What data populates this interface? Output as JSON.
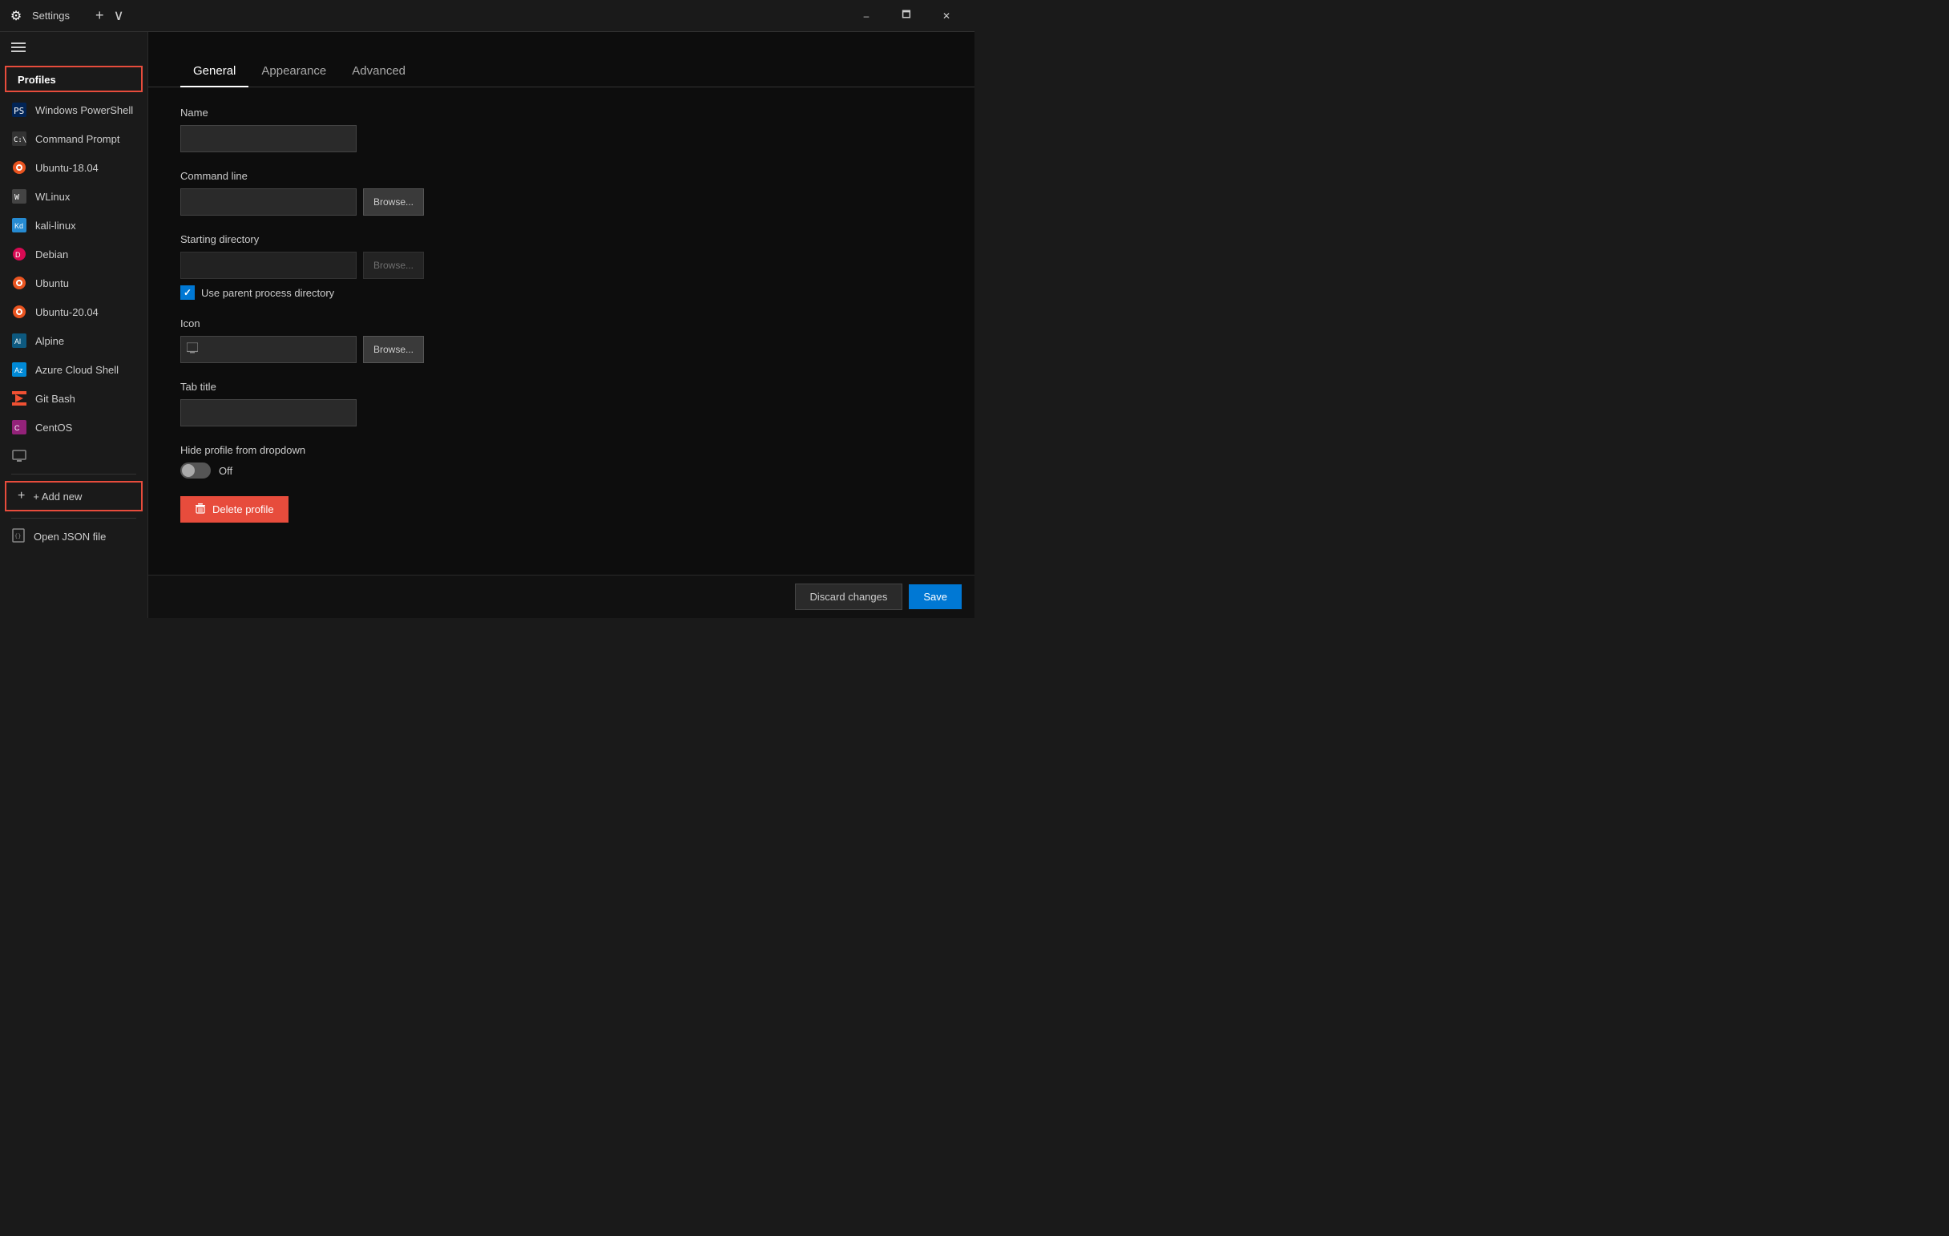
{
  "titleBar": {
    "icon": "⚙",
    "title": "Settings",
    "newTabIcon": "+",
    "dropdownIcon": "∨",
    "minimizeLabel": "–",
    "maximizeLabel": "🗖",
    "closeLabel": "✕"
  },
  "sidebar": {
    "hamburgerLabel": "Menu",
    "profilesLabel": "Profiles",
    "items": [
      {
        "id": "windows-powershell",
        "label": "Windows PowerShell",
        "iconType": "ps",
        "iconChar": "🔷"
      },
      {
        "id": "command-prompt",
        "label": "Command Prompt",
        "iconType": "cmd",
        "iconChar": "🖥"
      },
      {
        "id": "ubuntu-18",
        "label": "Ubuntu-18.04",
        "iconType": "ubuntu",
        "iconChar": "🔵"
      },
      {
        "id": "wlinux",
        "label": "WLinux",
        "iconType": "wlinux",
        "iconChar": ""
      },
      {
        "id": "kali-linux",
        "label": "kali-linux",
        "iconType": "kali",
        "iconChar": "🐉"
      },
      {
        "id": "debian",
        "label": "Debian",
        "iconType": "debian",
        "iconChar": "🌀"
      },
      {
        "id": "ubuntu",
        "label": "Ubuntu",
        "iconType": "ubuntu",
        "iconChar": "🔵"
      },
      {
        "id": "ubuntu-20",
        "label": "Ubuntu-20.04",
        "iconType": "u20",
        "iconChar": "🟠"
      },
      {
        "id": "alpine",
        "label": "Alpine",
        "iconType": "alpine",
        "iconChar": "🏔"
      },
      {
        "id": "azure-cloud-shell",
        "label": "Azure Cloud Shell",
        "iconType": "azure",
        "iconChar": "☁"
      },
      {
        "id": "git-bash",
        "label": "Git Bash",
        "iconType": "git",
        "iconChar": "◇"
      },
      {
        "id": "centos",
        "label": "CentOS",
        "iconType": "centos",
        "iconChar": "⚙"
      },
      {
        "id": "unknown",
        "label": "",
        "iconType": "monitor",
        "iconChar": "🖥"
      }
    ],
    "addNewLabel": "+ Add new",
    "openJsonLabel": "Open JSON file",
    "openJsonIcon": "📄"
  },
  "tabs": [
    {
      "id": "general",
      "label": "General",
      "active": true
    },
    {
      "id": "appearance",
      "label": "Appearance",
      "active": false
    },
    {
      "id": "advanced",
      "label": "Advanced",
      "active": false
    }
  ],
  "form": {
    "nameLabel": "Name",
    "namePlaceholder": "",
    "commandLineLabel": "Command line",
    "commandLinePlaceholder": "",
    "browseLabel": "Browse...",
    "startingDirectoryLabel": "Starting directory",
    "startingDirectoryPlaceholder": "",
    "useParentProcessLabel": "Use parent process directory",
    "iconLabel": "Icon",
    "iconPlaceholder": "",
    "tabTitleLabel": "Tab title",
    "tabTitlePlaceholder": "",
    "hideProfileLabel": "Hide profile from dropdown",
    "hideProfileToggleState": "Off",
    "deleteProfileLabel": "Delete profile"
  },
  "bottomBar": {
    "discardLabel": "Discard changes",
    "saveLabel": "Save"
  }
}
